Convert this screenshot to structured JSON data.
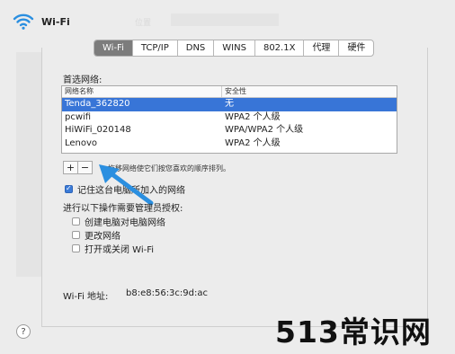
{
  "header": {
    "title": "Wi-Fi"
  },
  "tabs": [
    {
      "label": "Wi-Fi",
      "active": true
    },
    {
      "label": "TCP/IP",
      "active": false
    },
    {
      "label": "DNS",
      "active": false
    },
    {
      "label": "WINS",
      "active": false
    },
    {
      "label": "802.1X",
      "active": false
    },
    {
      "label": "代理",
      "active": false
    },
    {
      "label": "硬件",
      "active": false
    }
  ],
  "preferred_networks": {
    "title": "首选网络:",
    "columns": [
      "网络名称",
      "安全性"
    ],
    "rows": [
      {
        "name": "Tenda_362820",
        "security": "无",
        "selected": true
      },
      {
        "name": "pcwifi",
        "security": "WPA2 个人级",
        "selected": false
      },
      {
        "name": "HiWiFi_020148",
        "security": "WPA/WPA2 个人级",
        "selected": false
      },
      {
        "name": "Lenovo",
        "security": "WPA2 个人级",
        "selected": false
      }
    ],
    "add_label": "+",
    "remove_label": "−",
    "drag_hint": "拖移网络使它们按您喜欢的顺序排列。"
  },
  "remember_networks": {
    "label": "记住这台电脑所加入的网络",
    "checked": true
  },
  "admin": {
    "title": "进行以下操作需要管理员授权:",
    "options": [
      {
        "label": "创建电脑对电脑网络",
        "checked": false
      },
      {
        "label": "更改网络",
        "checked": false
      },
      {
        "label": "打开或关闭 Wi-Fi",
        "checked": false
      }
    ]
  },
  "address": {
    "label": "Wi-Fi 地址:",
    "value": "b8:e8:56:3c:9d:ac"
  },
  "help": {
    "label": "?"
  },
  "watermark": "513常识网",
  "colors": {
    "selection": "#3875d7",
    "arrow": "#2b8fe0",
    "checkbox": "#3b7bd8"
  },
  "icons": {
    "wifi": "wifi-icon",
    "arrow": "arrow-icon"
  }
}
